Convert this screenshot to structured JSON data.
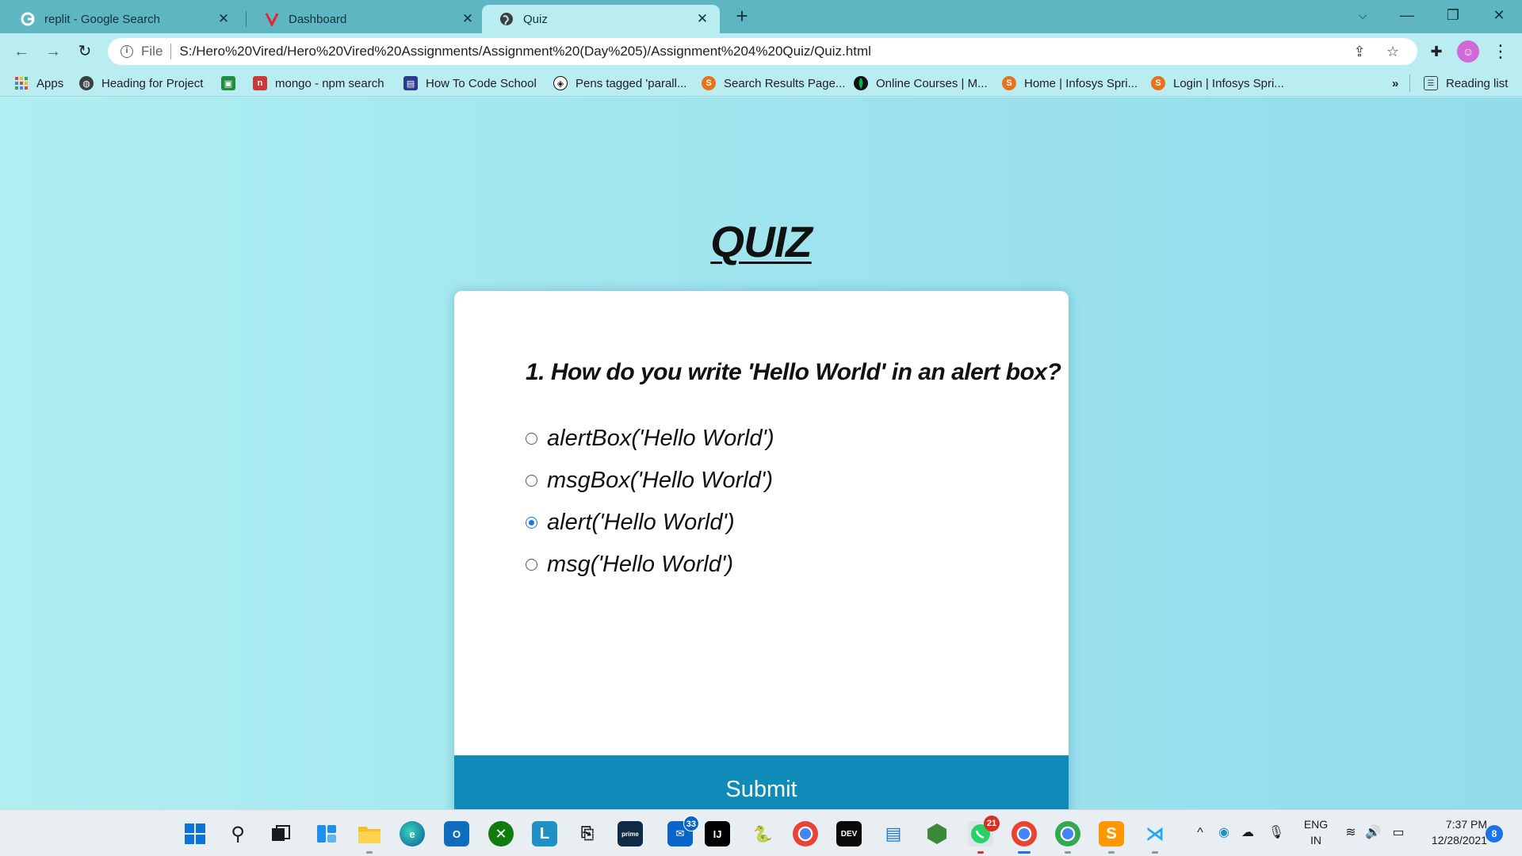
{
  "browser": {
    "tabs": [
      {
        "title": "replit - Google Search",
        "favicon": "google-icon",
        "active": false
      },
      {
        "title": "Dashboard",
        "favicon": "v-logo-icon",
        "active": false
      },
      {
        "title": "Quiz",
        "favicon": "globe-icon",
        "active": true
      }
    ],
    "new_tab_label": "+",
    "address": {
      "scheme_label": "File",
      "url": "S:/Hero%20Vired/Hero%20Vired%20Assignments/Assignment%20(Day%205)/Assignment%204%20Quiz/Quiz.html"
    },
    "bookmarks": [
      {
        "label": "Apps",
        "icon": "apps-grid-icon"
      },
      {
        "label": "Heading for Project",
        "icon": "globe-icon"
      },
      {
        "label": "",
        "icon": "green-app-icon"
      },
      {
        "label": "mongo - npm search",
        "icon": "npm-icon"
      },
      {
        "label": "How To Code School",
        "icon": "school-icon"
      },
      {
        "label": "Pens tagged 'parall...",
        "icon": "codepen-icon"
      },
      {
        "label": "Search Results Page...",
        "icon": "infosys-icon"
      },
      {
        "label": "Online Courses | M...",
        "icon": "mongodb-leaf-icon"
      },
      {
        "label": "Home | Infosys Spri...",
        "icon": "infosys-icon"
      },
      {
        "label": "Login | Infosys Spri...",
        "icon": "infosys-icon"
      }
    ],
    "bookmarks_overflow": "»",
    "reading_list_label": "Reading list"
  },
  "quiz": {
    "heading": "QUIZ",
    "question": "1. How do you write 'Hello World' in an alert box?",
    "answers": [
      {
        "text": "alertBox('Hello World')",
        "selected": false
      },
      {
        "text": "msgBox('Hello World')",
        "selected": false
      },
      {
        "text": "alert('Hello World')",
        "selected": true
      },
      {
        "text": "msg('Hello World')",
        "selected": false
      }
    ],
    "submit_label": "Submit"
  },
  "taskbar": {
    "badges": {
      "mail": "33",
      "whatsapp": "21"
    },
    "language": {
      "line1": "ENG",
      "line2": "IN"
    },
    "time": "7:37 PM",
    "date": "12/28/2021",
    "notification_count": "8"
  },
  "colors": {
    "page_bg": "#a6e9f0",
    "submit_bg": "#0e8bb8",
    "selected_radio": "#1a73e8",
    "tabstrip": "#5fb6c3"
  }
}
